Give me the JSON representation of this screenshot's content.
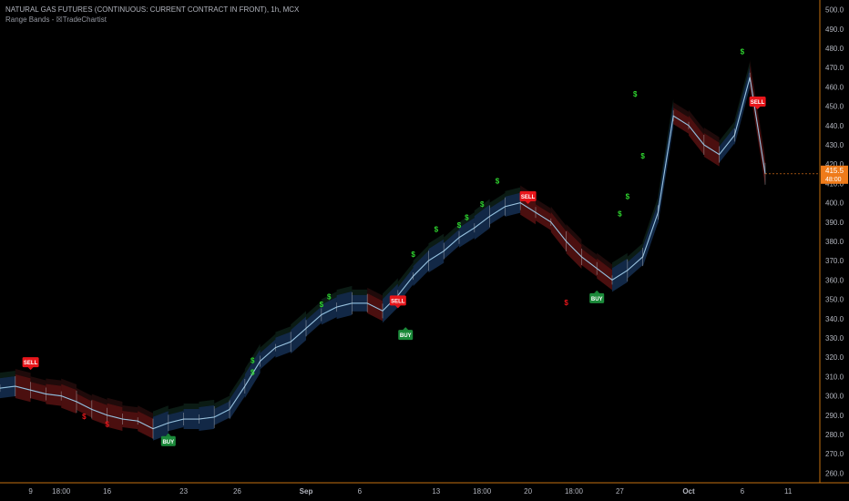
{
  "legend": {
    "title": "NATURAL GAS FUTURES (CONTINUOUS: CURRENT CONTRACT IN FRONT), 1h, MCX",
    "indicator": "Range Bands - ☒TradeChartist"
  },
  "colors": {
    "background": "#000000",
    "axis_text": "#b2b5be",
    "axis_line": "#c4700f",
    "buy": "#1b8a3a",
    "sell": "#e8161b",
    "dollar": "#2fd62f",
    "price_tag": "#ef7b1a",
    "band_up": "#2a5fa8",
    "band_down": "#b32424",
    "midline": "#4aa3d9"
  },
  "price_tag": {
    "price": "415.5",
    "time": "48:00"
  },
  "chart_data": {
    "type": "line",
    "symbol": "NATURAL GAS FUTURES (CONTINUOUS: CURRENT CONTRACT IN FRONT)",
    "timeframe": "1h",
    "ylim": [
      255,
      505
    ],
    "y_ticks": [
      260,
      270,
      280,
      290,
      300,
      310,
      320,
      330,
      340,
      350,
      360,
      370,
      380,
      390,
      400,
      410,
      420,
      430,
      440,
      450,
      460,
      470,
      480,
      490,
      500
    ],
    "x_ticks": [
      "9",
      "18:00",
      "16",
      "23",
      "26",
      "Sep",
      "6",
      "13",
      "18:00",
      "20",
      "18:00",
      "27",
      "Oct",
      "6",
      "11"
    ],
    "x_index_range": [
      0,
      100
    ],
    "x_tick_index": [
      4,
      8,
      14,
      24,
      31,
      40,
      47,
      57,
      63,
      69,
      75,
      81,
      90,
      97,
      103
    ],
    "series": [
      {
        "name": "",
        "x": [
          0,
          2,
          4,
          6,
          8,
          10,
          12,
          14,
          16,
          18,
          20,
          22,
          24,
          26,
          28,
          30,
          32,
          34,
          36,
          38,
          40,
          42,
          44,
          46,
          48,
          50,
          52,
          54,
          56,
          58,
          60,
          62,
          64,
          66,
          68,
          70,
          72,
          74,
          76,
          78,
          80,
          82,
          84,
          86,
          88,
          90,
          92,
          94,
          96,
          98,
          100
        ],
        "y": [
          304,
          305,
          303,
          301,
          300,
          297,
          293,
          290,
          288,
          287,
          283,
          286,
          288,
          288,
          289,
          293,
          305,
          318,
          325,
          328,
          335,
          342,
          346,
          348,
          348,
          344,
          352,
          362,
          370,
          375,
          382,
          387,
          393,
          398,
          400,
          395,
          390,
          380,
          372,
          366,
          360,
          365,
          372,
          395,
          445,
          440,
          430,
          425,
          435,
          465,
          415
        ]
      }
    ],
    "signals": [
      {
        "type": "SELL",
        "x": 4,
        "y": 312
      },
      {
        "type": "BUY",
        "x": 22,
        "y": 282
      },
      {
        "type": "SELL",
        "x": 52,
        "y": 344
      },
      {
        "type": "BUY",
        "x": 53,
        "y": 337
      },
      {
        "type": "SELL",
        "x": 69,
        "y": 398
      },
      {
        "type": "BUY",
        "x": 78,
        "y": 356
      },
      {
        "type": "SELL",
        "x": 99,
        "y": 447
      }
    ],
    "dollar_marks": [
      {
        "color": "red",
        "x": 11,
        "y": 288
      },
      {
        "color": "red",
        "x": 14,
        "y": 284
      },
      {
        "color": "green",
        "x": 33,
        "y": 317
      },
      {
        "color": "green",
        "x": 33,
        "y": 311
      },
      {
        "color": "green",
        "x": 43,
        "y": 350
      },
      {
        "color": "green",
        "x": 42,
        "y": 346
      },
      {
        "color": "green",
        "x": 54,
        "y": 372
      },
      {
        "color": "green",
        "x": 57,
        "y": 385
      },
      {
        "color": "green",
        "x": 60,
        "y": 387
      },
      {
        "color": "green",
        "x": 61,
        "y": 391
      },
      {
        "color": "green",
        "x": 65,
        "y": 410
      },
      {
        "color": "green",
        "x": 63,
        "y": 398
      },
      {
        "color": "red",
        "x": 74,
        "y": 347
      },
      {
        "color": "green",
        "x": 83,
        "y": 455
      },
      {
        "color": "green",
        "x": 84,
        "y": 423
      },
      {
        "color": "green",
        "x": 82,
        "y": 402
      },
      {
        "color": "green",
        "x": 81,
        "y": 393
      },
      {
        "color": "green",
        "x": 97,
        "y": 477
      }
    ]
  }
}
